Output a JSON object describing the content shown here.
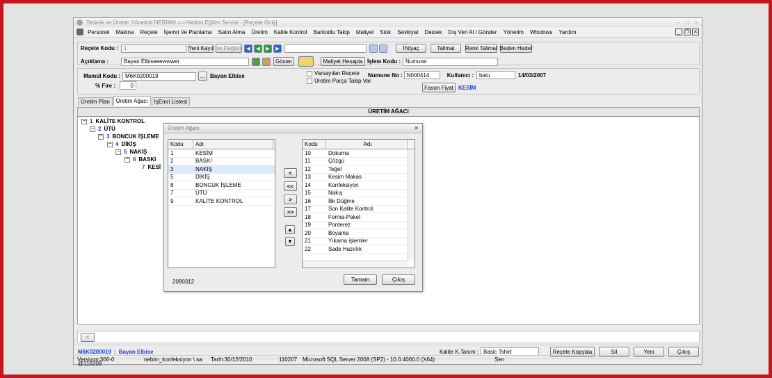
{
  "window": {
    "title": "Tedarik ve Üretim Yönetimi   NEBİM® ==>Nebim Eğitim Servisi - [Reçete Giriş]"
  },
  "menu": [
    "Personel",
    "Makina",
    "Reçete",
    "İşemri Ve Planlama",
    "Satın Alma",
    "Üretim",
    "Kalite Kontrol",
    "Barkodlu Takip",
    "Maliyet",
    "Stok",
    "Sevkiyat",
    "Destek",
    "Dış Veri Al / Gönder",
    "Yönetim",
    "Windows",
    "Yardım"
  ],
  "toolbar": {
    "recete_kodu_label": "Reçete Kodu :",
    "recete_kodu_value": "1",
    "yeni_kayit": "Yeni Kayıt",
    "no_degistir": "No.Değiştir",
    "ihtiyac": "İhtiyaç",
    "talimat": "Talimat",
    "renk_talimat": "Renk Talimat",
    "beden_hedef": "Beden Hedef",
    "aciklama_label": "Açıklama :",
    "aciklama_value": "Bayan Elbiseeewwwer",
    "goster": "Göster",
    "maliyet_hesapla": "Maliyet Hesapla",
    "islem_kodu_label": "İşlem Kodu :",
    "islem_kodu_value": "Numune"
  },
  "form": {
    "mamul_kodu_label": "Mamül Kodu :",
    "mamul_kodu_value": "M6K0200019",
    "mamul_name": "Bayan Elbise",
    "fire_label": "% Fire :",
    "fire_value": "0",
    "varsayilan_recete": "Varsayılan Reçete",
    "uretim_parca": "Üretim Parça Takip Var",
    "numune_no_label": "Numune No :",
    "numune_no_value": "N000414",
    "kullanici_label": "Kullanıcı :",
    "kullanici_value": "batu",
    "date": "14/03/2007",
    "fason_fiyat": "Fason Fiyat",
    "kesim": "KESİM"
  },
  "tabs": [
    "Üretim Plan",
    "Üretim Ağacı",
    "İşEmri Listesi"
  ],
  "tree": {
    "header": "ÜRETİM AĞACI",
    "nodes": [
      {
        "num": "1",
        "label": "KALİTE KONTROL"
      },
      {
        "num": "2",
        "label": "ÜTÜ"
      },
      {
        "num": "3",
        "label": "BONCUK İŞLEME"
      },
      {
        "num": "4",
        "label": "DİKİŞ"
      },
      {
        "num": "5",
        "label": "NAKIŞ"
      },
      {
        "num": "6",
        "label": "BASKI"
      },
      {
        "num": "7",
        "label": "KESİ"
      }
    ]
  },
  "dialog": {
    "title": "Üretim Ağacı",
    "left_headers": [
      "Kodu",
      "Adı"
    ],
    "left_rows": [
      {
        "kodu": "1",
        "adi": "KESİM"
      },
      {
        "kodu": "2",
        "adi": "BASKI"
      },
      {
        "kodu": "3",
        "adi": "NAKIŞ"
      },
      {
        "kodu": "5",
        "adi": "DİKİŞ"
      },
      {
        "kodu": "8",
        "adi": "BONCUK İŞLEME"
      },
      {
        "kodu": "7",
        "adi": "ÜTÜ"
      },
      {
        "kodu": "9",
        "adi": "KALİTE KONTROL"
      }
    ],
    "right_headers": [
      "Kodu",
      "Adı"
    ],
    "right_rows": [
      {
        "kodu": "10",
        "adi": "Dokuma"
      },
      {
        "kodu": "11",
        "adi": "Çözgü"
      },
      {
        "kodu": "12",
        "adi": "Teğel"
      },
      {
        "kodu": "13",
        "adi": "Kesim Makas"
      },
      {
        "kodu": "14",
        "adi": "Konfeksiyon"
      },
      {
        "kodu": "15",
        "adi": "Nakış"
      },
      {
        "kodu": "16",
        "adi": "İlik Düğme"
      },
      {
        "kodu": "17",
        "adi": "Son Kalite Kontrol"
      },
      {
        "kodu": "18",
        "adi": "Forma-Paket"
      },
      {
        "kodu": "19",
        "adi": "Ponterez"
      },
      {
        "kodu": "20",
        "adi": "Boyama"
      },
      {
        "kodu": "21",
        "adi": "Yıkama işlemler"
      },
      {
        "kodu": "22",
        "adi": "Sade Hazırlık"
      }
    ],
    "buttons": {
      "single_left": "<",
      "all_left": "<<",
      "single_right": ">",
      "all_right": ">>"
    },
    "code": "2090312",
    "tamam": "Tamam",
    "cikis": "Çıkış"
  },
  "footer": {
    "mamul": "M6K0200019",
    "separator": ":",
    "mamul_name": "Bayan Elbise",
    "kalite_label": "Kalite K.Tanım :",
    "kalite_value": "Basic Tshirt",
    "recete_kopyala": "Reçete Kopyala",
    "sil": "Sil",
    "yeni": "Yeni",
    "cikis": "Çıkış",
    "close_glyph": "✕"
  },
  "status": {
    "user": "@110209",
    "version": "Versiyon:306-0",
    "db": "nebim_konfeksiyon \\ sa",
    "date": "Tarih:30/12/2010",
    "code": "110207",
    "server": "Microsoft SQL Server 2008 (SP2) - 10.0.4000.0 (X64)",
    "extra": "Sen"
  }
}
